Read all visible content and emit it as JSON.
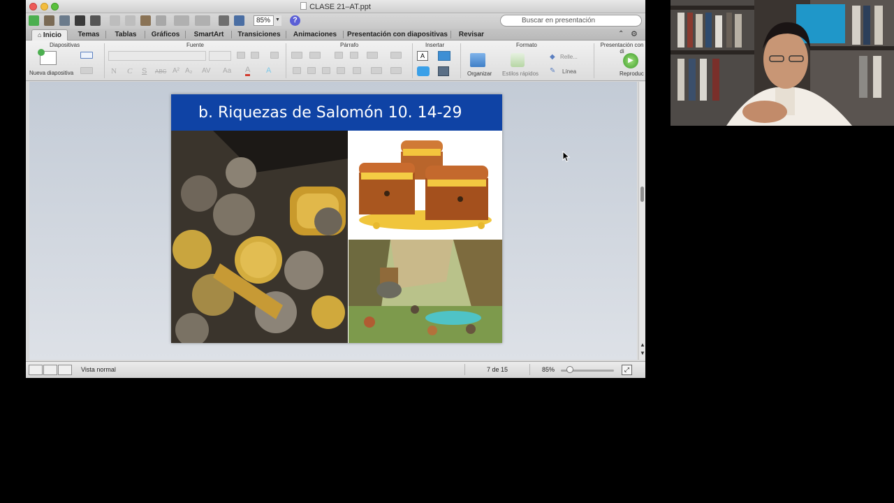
{
  "window": {
    "title": "CLASE 21–AT.ppt",
    "zoom": "85%",
    "search_placeholder": "Buscar en presentación"
  },
  "tabs": [
    {
      "label": "Inicio",
      "active": true
    },
    {
      "label": "Temas"
    },
    {
      "label": "Tablas"
    },
    {
      "label": "Gráficos"
    },
    {
      "label": "SmartArt"
    },
    {
      "label": "Transiciones"
    },
    {
      "label": "Animaciones"
    },
    {
      "label": "Presentación con diapositivas"
    },
    {
      "label": "Revisar"
    }
  ],
  "ribbon": {
    "groups": {
      "diapositivas": "Diapositivas",
      "fuente": "Fuente",
      "parrafo": "Párrafo",
      "insertar": "Insertar",
      "formato": "Formato",
      "presentacion": "Presentación con di"
    },
    "new_slide_label": "Nueva diapositiva",
    "organizar_label": "Organizar",
    "estilos_label": "Estilos rápidos",
    "relleno_label": "Relle...",
    "linea_label": "Línea",
    "reproducir_label": "Reproduc"
  },
  "slide": {
    "title": "b. Riquezas  de Salomón 10. 14-29"
  },
  "status": {
    "view": "Vista normal",
    "page": "7 de 15",
    "zoom": "85%",
    "zoom_level": 0.17
  },
  "colors": {
    "slide_title_bar": "#0f43a5",
    "accent": "#5b5fd6"
  }
}
